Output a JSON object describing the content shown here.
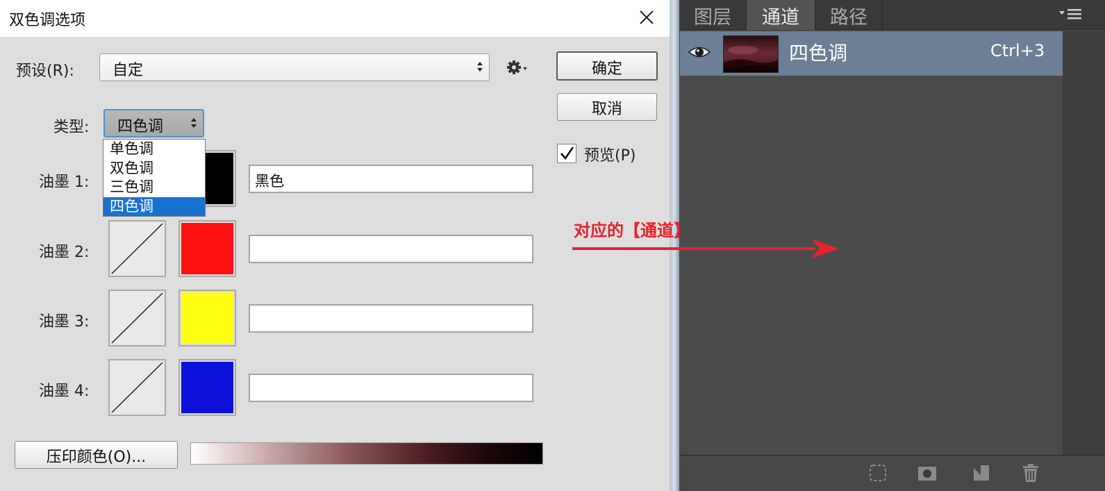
{
  "dialog": {
    "title": "双色调选项",
    "preset_label": "预设(R):",
    "preset_value": "自定",
    "type_label": "类型:",
    "type_value": "四色调",
    "type_options": [
      "单色调",
      "双色调",
      "三色调",
      "四色调"
    ],
    "ok_label": "确定",
    "cancel_label": "取消",
    "preview_label": "预览(P)",
    "preview_checked": true,
    "inks": [
      {
        "label": "油墨 1:",
        "name": "黑色",
        "color": "#000000"
      },
      {
        "label": "油墨 2:",
        "name": "",
        "color": "#ff1010"
      },
      {
        "label": "油墨 3:",
        "name": "",
        "color": "#ffff14"
      },
      {
        "label": "油墨 4:",
        "name": "",
        "color": "#0c10d8"
      }
    ],
    "overprint_label": "压印颜色(O)..."
  },
  "panel": {
    "tabs": [
      "图层",
      "通道",
      "路径"
    ],
    "active_tab": "通道",
    "channel": {
      "name": "四色调",
      "shortcut": "Ctrl+3"
    },
    "footer_icons": [
      "load-selection-icon",
      "save-selection-icon",
      "new-channel-icon",
      "delete-channel-icon"
    ]
  },
  "annotation": {
    "label": "对应的【通道】",
    "color": "#e8212b"
  }
}
